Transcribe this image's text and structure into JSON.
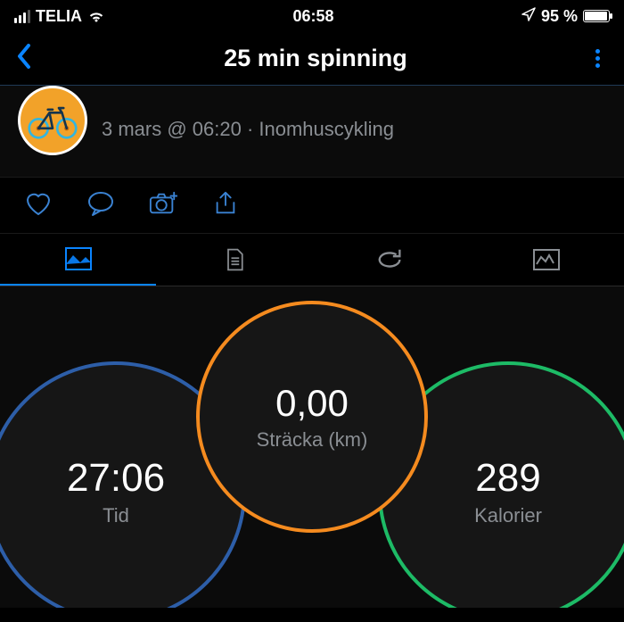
{
  "status_bar": {
    "carrier": "TELIA",
    "time": "06:58",
    "battery_pct": "95 %"
  },
  "nav": {
    "title": "25 min spinning"
  },
  "activity": {
    "meta_line": "3 mars @ 06:20 · Inomhuscykling"
  },
  "icons": {
    "heart": "heart-icon",
    "comment": "comment-icon",
    "camera": "camera-icon",
    "share": "share-icon",
    "map": "map-icon",
    "details": "details-icon",
    "laps": "laps-icon",
    "charts": "charts-icon"
  },
  "metrics": {
    "time": {
      "value": "27:06",
      "label": "Tid"
    },
    "distance": {
      "value": "0,00",
      "label": "Sträcka (km)"
    },
    "calories": {
      "value": "289",
      "label": "Kalorier"
    }
  },
  "colors": {
    "accent": "#0a84ff",
    "ring_time": "#2d5ea8",
    "ring_distance": "#f58b1f",
    "ring_calories": "#1dbb66"
  }
}
